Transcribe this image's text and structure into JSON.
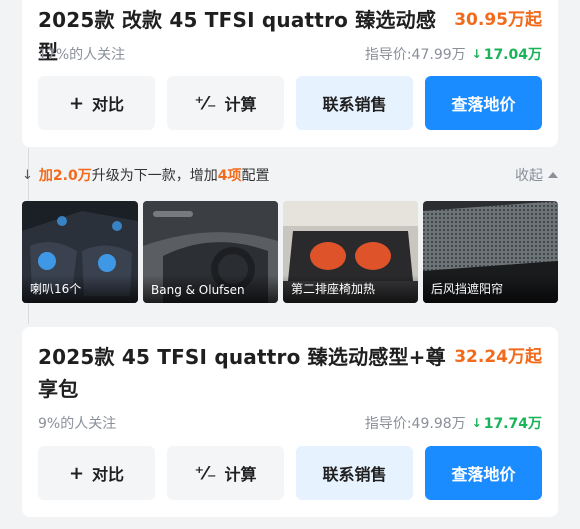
{
  "card1": {
    "title": "2025款 改款 45 TFSI quattro 臻选动感型",
    "price": "30.95万起",
    "attention_pct": "17%",
    "attention_text": "的人关注",
    "guide_price": "指导价:47.99万",
    "drop": "17.04万",
    "buttons": {
      "compare": "对比",
      "calc": "计算",
      "contact": "联系销售",
      "floor_price": "查落地价"
    }
  },
  "upgrade": {
    "prefix": "加",
    "amount": "2.0万",
    "middle": "升级为下一款，增加",
    "count": "4项",
    "suffix": "配置",
    "collapse": "收起"
  },
  "features": [
    {
      "caption": "喇叭16个"
    },
    {
      "caption": "Bang & Olufsen"
    },
    {
      "caption": "第二排座椅加热"
    },
    {
      "caption": "后风挡遮阳帘"
    }
  ],
  "card2": {
    "title_line1": "2025款 45 TFSI quattro 臻选动感型+尊",
    "title_line2": "享包",
    "price": "32.24万起",
    "attention_pct": "9%",
    "attention_text": "的人关注",
    "guide_price": "指导价:49.98万",
    "drop": "17.74万",
    "buttons": {
      "compare": "对比",
      "calc": "计算",
      "contact": "联系销售",
      "floor_price": "查落地价"
    }
  },
  "colors": {
    "accent_orange": "#f26a1b",
    "drop_green": "#19b35a",
    "primary_blue": "#1a8cff"
  }
}
